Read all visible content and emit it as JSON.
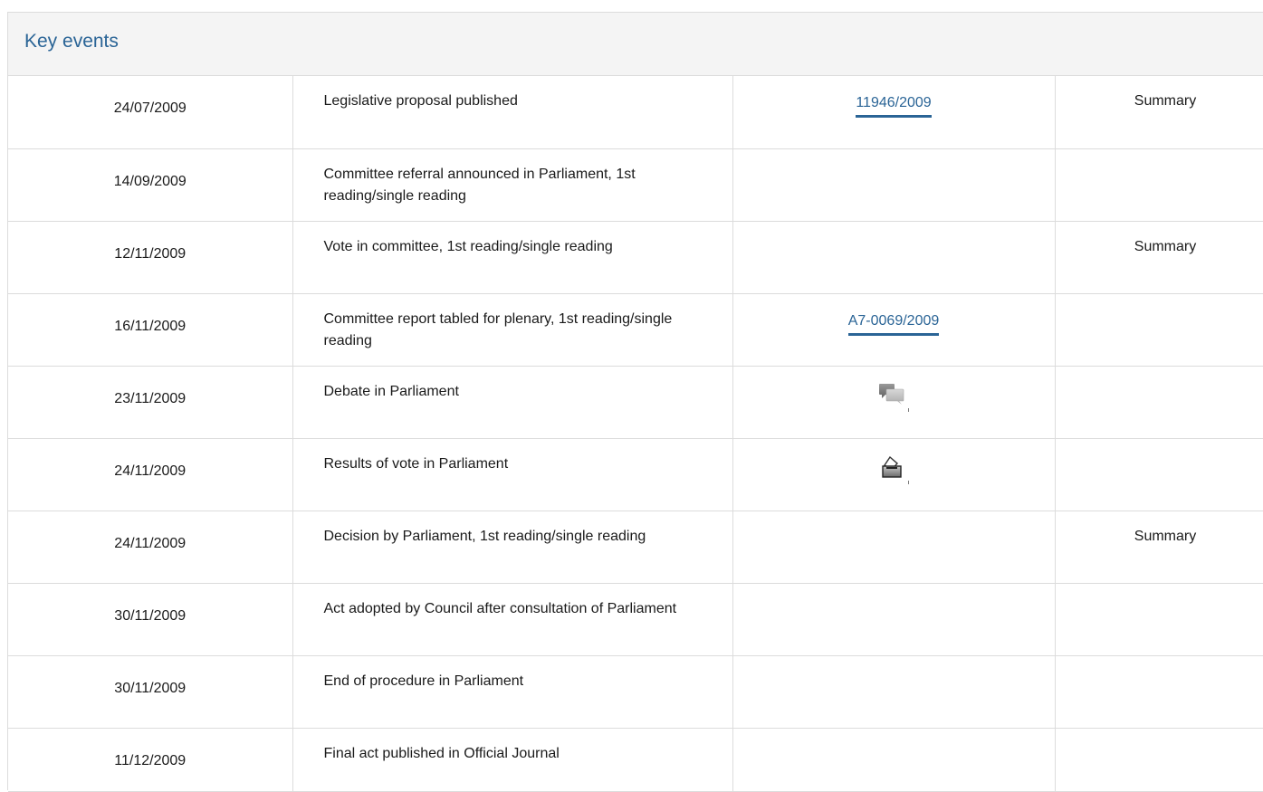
{
  "panel": {
    "title": "Key events"
  },
  "events": [
    {
      "date": "24/07/2009",
      "event": "Legislative proposal published",
      "reference": "11946/2009",
      "summary": "Summary"
    },
    {
      "date": "14/09/2009",
      "event": "Committee referral announced in Parliament, 1st reading/single reading",
      "reference": "",
      "summary": ""
    },
    {
      "date": "12/11/2009",
      "event": "Vote in committee, 1st reading/single reading",
      "reference": "",
      "summary": "Summary"
    },
    {
      "date": "16/11/2009",
      "event": "Committee report tabled for plenary, 1st reading/single reading",
      "reference": "A7-0069/2009",
      "summary": ""
    },
    {
      "date": "23/11/2009",
      "event": "Debate in Parliament",
      "icon": "debate-icon",
      "summary": ""
    },
    {
      "date": "24/11/2009",
      "event": "Results of vote in Parliament",
      "icon": "ballot-box-icon",
      "summary": ""
    },
    {
      "date": "24/11/2009",
      "event": "Decision by Parliament, 1st reading/single reading",
      "reference": "",
      "summary": "Summary"
    },
    {
      "date": "30/11/2009",
      "event": "Act adopted by Council after consultation of Parliament",
      "reference": "",
      "summary": ""
    },
    {
      "date": "30/11/2009",
      "event": "End of procedure in Parliament",
      "reference": "",
      "summary": ""
    },
    {
      "date": "11/12/2009",
      "event": "Final act published in Official Journal",
      "reference": "",
      "summary": ""
    }
  ],
  "colors": {
    "link": "#2a6496",
    "header_bg": "#f4f4f4",
    "border": "#dcdcdc"
  }
}
